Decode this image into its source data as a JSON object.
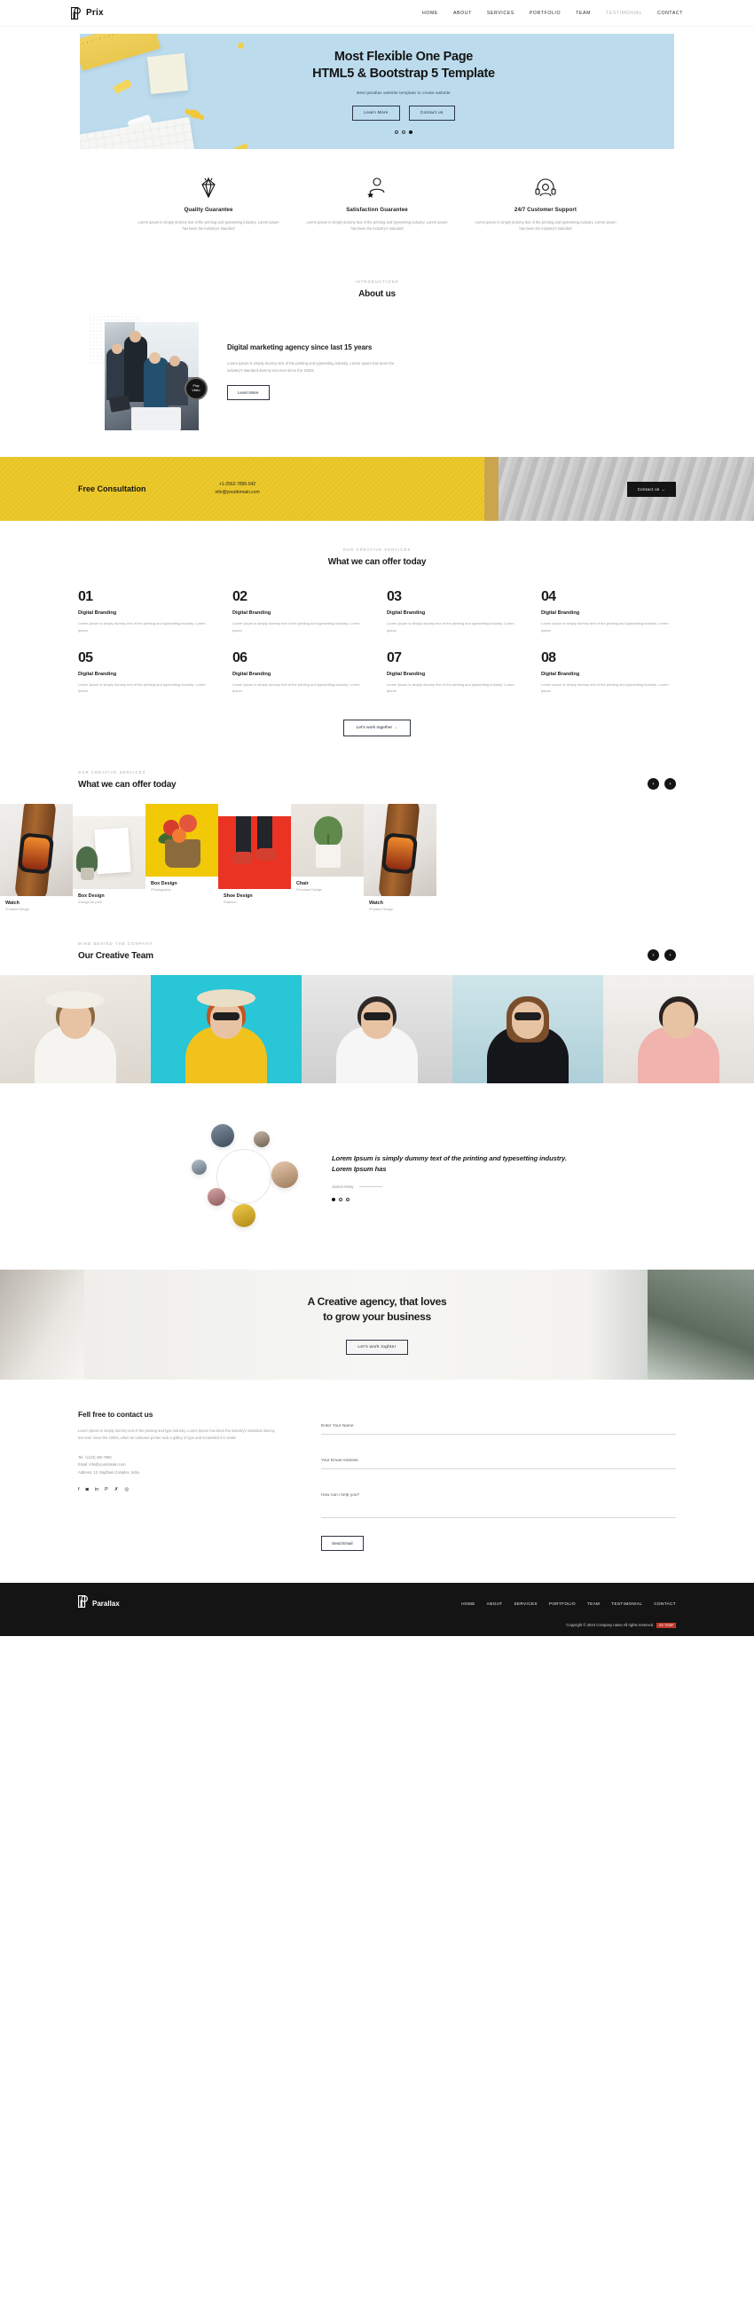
{
  "header": {
    "brand": "Prix",
    "nav": [
      {
        "label": "HOME",
        "muted": false
      },
      {
        "label": "ABOUT",
        "muted": false
      },
      {
        "label": "SERVICES",
        "muted": false
      },
      {
        "label": "PORTFOLIO",
        "muted": false
      },
      {
        "label": "TEAM",
        "muted": false
      },
      {
        "label": "TESTIMONIAL",
        "muted": true
      },
      {
        "label": "CONTACT",
        "muted": false
      }
    ]
  },
  "hero": {
    "title_line1": "Most Flexible One Page",
    "title_line2": "HTML5 & Bootstrap 5 Template",
    "subtitle": "Best parallax website template to create website",
    "btn_primary": "Learn More",
    "btn_secondary": "Contact us",
    "dots": 3,
    "active_dot": 2
  },
  "features": [
    {
      "icon": "diamond-icon",
      "title": "Quality Guarantee",
      "text": "Lorem ipsum is simply dummy text of the printing and typesetting industry. Lorem Ipsum has been the industry's standard"
    },
    {
      "icon": "person-stars-icon",
      "title": "Satisfaction Guarantee",
      "text": "Lorem ipsum is simply dummy text of the printing and typesetting industry. Lorem Ipsum has been the industry's standard"
    },
    {
      "icon": "headset-support-icon",
      "title": "24/7 Customer Support",
      "text": "Lorem ipsum is simply dummy text of the printing and typesetting industry. Lorem Ipsum has been the industry's standard"
    }
  ],
  "about": {
    "eyebrow": "INTRODUCTIONS",
    "title": "About us",
    "play_line1": "Play",
    "play_line2": "Video",
    "heading": "Digital marketing agency since last 15 years",
    "paragraph": "Lorem Ipsum is simply dummy text of the printing and typesetting industry. Lorem Ipsum has been the industry's standard dummy text ever since the 1500s,",
    "button": "Learn More"
  },
  "consultation": {
    "title": "Free Consultation",
    "phone": "+1-2562-7895-542",
    "email": "info@yourdomain.com",
    "button": "Contact us →"
  },
  "services": {
    "eyebrow": "OUR CREATIVE SERVICES",
    "title": "What we can offer today",
    "cta": "Let's work together →",
    "items": [
      {
        "num": "01",
        "name": "Digital Branding",
        "desc": "Lorem Ipsum is simply dummy text of the printing and typesetting industry. Lorem Ipsum"
      },
      {
        "num": "02",
        "name": "Digital Branding",
        "desc": "Lorem Ipsum is simply dummy text of the printing and typesetting industry. Lorem Ipsum"
      },
      {
        "num": "03",
        "name": "Digital Branding",
        "desc": "Lorem Ipsum is simply dummy text of the printing and typesetting industry. Lorem Ipsum"
      },
      {
        "num": "04",
        "name": "Digital Branding",
        "desc": "Lorem Ipsum is simply dummy text of the printing and typesetting industry. Lorem Ipsum"
      },
      {
        "num": "05",
        "name": "Digital Branding",
        "desc": "Lorem Ipsum is simply dummy text of the printing and typesetting industry. Lorem Ipsum"
      },
      {
        "num": "06",
        "name": "Digital Branding",
        "desc": "Lorem Ipsum is simply dummy text of the printing and typesetting industry. Lorem Ipsum"
      },
      {
        "num": "07",
        "name": "Digital Branding",
        "desc": "Lorem Ipsum is simply dummy text of the printing and typesetting industry. Lorem Ipsum"
      },
      {
        "num": "08",
        "name": "Digital Branding",
        "desc": "Lorem Ipsum is simply dummy text of the printing and typesetting industry. Lorem Ipsum"
      }
    ]
  },
  "portfolio": {
    "eyebrow": "OUR CREATIVE SERVICES",
    "title": "What we can offer today",
    "prev_icon": "chevron-left-icon",
    "next_icon": "chevron-right-icon",
    "items": [
      {
        "title": "Watch",
        "category": "/Product Design",
        "thumb": "watch"
      },
      {
        "title": "Box Design",
        "category": "/Design for print",
        "thumb": "box1"
      },
      {
        "title": "Box Design",
        "category": "/Photography",
        "thumb": "flowers"
      },
      {
        "title": "Shoe Design",
        "category": "/Fashion",
        "thumb": "shoe"
      },
      {
        "title": "Chair",
        "category": "/Furniture Design",
        "thumb": "chair"
      },
      {
        "title": "Watch",
        "category": "/Product Design",
        "thumb": "watch"
      }
    ]
  },
  "team": {
    "eyebrow": "MIND BEHIND THE COMPANY",
    "title": "Our Creative Team",
    "prev_icon": "chevron-left-icon",
    "next_icon": "chevron-right-icon",
    "members": 5
  },
  "testimonial": {
    "quote": "Lorem Ipsum is simply dummy text of the printing and typesetting industry. Lorem Ipsum has",
    "author": "James Hairy",
    "dots": 3,
    "active_dot": 0
  },
  "cta": {
    "line1": "A Creative agency, that loves",
    "line2": "to grow your business",
    "button": "Let's work toghter"
  },
  "contact": {
    "heading": "Fell free to contact us",
    "paragraph": "Lorem Ipsum is simply dummy text of the printing and type industry. Lorem Ipsum has been the industry's standard dummy text ever since the 1500s, when an unknown printer took a galley of type and scrambled it to make",
    "tel": "Tel: +(123) 456 7890",
    "email": "Email: info@yourdomain.com",
    "address": "Address: 12, Rajdhani Complex, India",
    "socials": [
      "facebook-icon",
      "instagram-icon",
      "linkedin-icon",
      "pinterest-icon",
      "twitter-icon",
      "dribbble-icon"
    ],
    "form": {
      "name_placeholder": "Enter Your Name",
      "email_placeholder": "Your Email Address",
      "message_placeholder": "How can i help you?",
      "submit": "Send Email"
    }
  },
  "footer": {
    "brand": "Parallax",
    "nav": [
      "HOME",
      "ABOUT",
      "SERVICES",
      "PORTFOLIO",
      "TEAM",
      "TESTIMONIAL",
      "CONTACT"
    ],
    "copyright": "Copyright © 2024 Company name All rights reserved.",
    "tag": "BY TEMP"
  }
}
